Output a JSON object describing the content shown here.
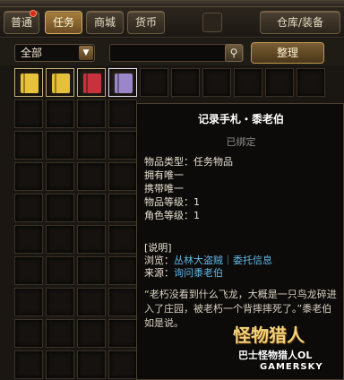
{
  "tabs": [
    {
      "label": "普通",
      "active": false,
      "badge": true
    },
    {
      "label": "任务",
      "active": true,
      "badge": false
    },
    {
      "label": "商城",
      "active": false,
      "badge": false
    },
    {
      "label": "货币",
      "active": false,
      "badge": false
    }
  ],
  "storage_button": "仓库/装备",
  "filter": {
    "category": "全部",
    "search_value": "",
    "sort_label": "整理"
  },
  "inventory": {
    "items": [
      {
        "slot": 0,
        "color": "#e8c23a",
        "icon": "yellow-scroll-icon"
      },
      {
        "slot": 1,
        "color": "#e5c03a",
        "icon": "yellow-scroll-icon"
      },
      {
        "slot": 2,
        "color": "#c8323f",
        "icon": "red-book-icon"
      },
      {
        "slot": 3,
        "color": "#9a86c8",
        "icon": "purple-book-icon"
      }
    ],
    "selected_slot": 3
  },
  "tooltip": {
    "title": "记录手札・黍老伯",
    "bound": "已绑定",
    "stats": [
      "物品类型：任务物品",
      "拥有唯一",
      "携带唯一",
      "物品等级：1",
      "角色等级：1"
    ],
    "section": "[说明]",
    "browse_label": "浏览：",
    "browse_value": "丛林大盗贼｜委托信息",
    "source_label": "来源：",
    "source_value": "询问黍老伯",
    "quote": "“老朽没看到什么飞龙，大概是一只鸟龙碎进入了庄园，被老朽一个背摔摔死了。”黍老伯如是说。"
  },
  "watermark": {
    "title": "怪物猎人",
    "subtitle": "巴士怪物猎人OL",
    "site": "GAMERSKY"
  },
  "colors": {
    "accent": "#d6ac5a",
    "link": "#5fb7e6",
    "badge": "#d62b1a"
  }
}
